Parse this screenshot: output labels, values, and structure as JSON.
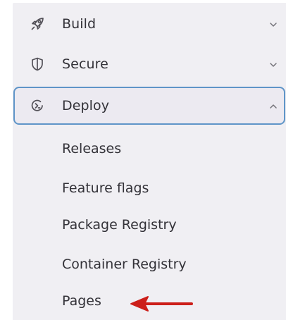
{
  "sidebar": {
    "items": [
      {
        "label": "Build",
        "icon": "rocket-icon",
        "state": "collapsed"
      },
      {
        "label": "Secure",
        "icon": "shield-icon",
        "state": "collapsed"
      },
      {
        "label": "Deploy",
        "icon": "deploy-icon",
        "state": "expanded"
      }
    ],
    "deploy_subitems": [
      {
        "label": "Releases"
      },
      {
        "label": "Feature flags"
      },
      {
        "label": "Package Registry"
      },
      {
        "label": "Container Registry"
      },
      {
        "label": "Pages"
      }
    ]
  },
  "annotation": {
    "icon": "red-arrow-icon",
    "color": "#cc1f1a"
  },
  "colors": {
    "sidebar_bg": "#f0eff3",
    "focus_border": "#5f95c8",
    "text": "#333238",
    "icon": "#535158"
  }
}
